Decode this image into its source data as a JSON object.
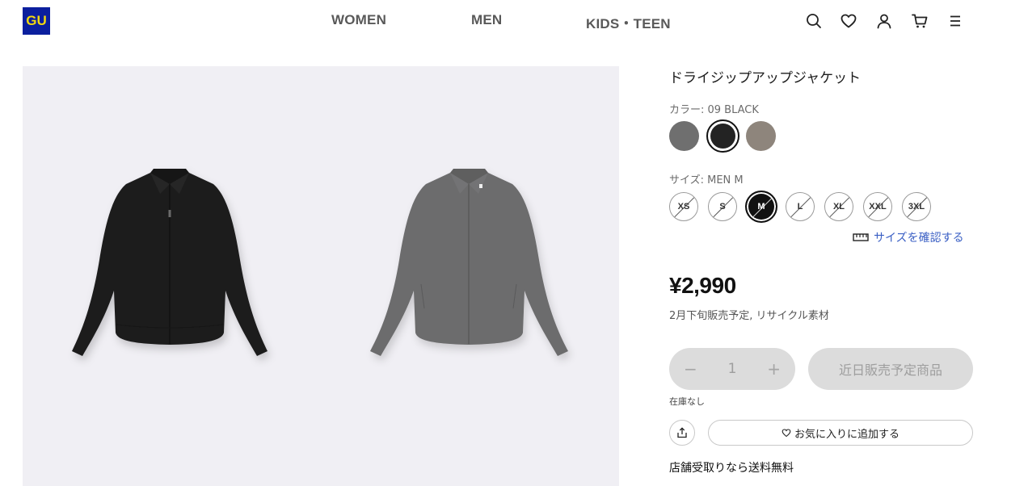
{
  "header": {
    "logo": "GU",
    "nav": [
      "WOMEN",
      "MEN",
      "KIDS・TEEN"
    ],
    "icons": [
      "search-icon",
      "heart-icon",
      "user-icon",
      "cart-icon",
      "menu-icon"
    ]
  },
  "gallery": {
    "images": [
      {
        "description_color": "#1e1e1e",
        "alt": "black jacket"
      },
      {
        "description_color": "#6c6c6d",
        "alt": "gray jacket"
      }
    ],
    "background": "#f0eff4"
  },
  "product": {
    "title": "ドライジップアップジャケット",
    "color_label": "カラー: 09 BLACK",
    "colors": [
      {
        "hex": "#6f6f6f",
        "selected": false
      },
      {
        "hex": "#232323",
        "selected": true
      },
      {
        "hex": "#8e857c",
        "selected": false
      }
    ],
    "size_label": "サイズ: MEN M",
    "sizes": [
      {
        "label": "XS",
        "selected": false,
        "unavailable": true
      },
      {
        "label": "S",
        "selected": false,
        "unavailable": true
      },
      {
        "label": "M",
        "selected": true,
        "unavailable": true
      },
      {
        "label": "L",
        "selected": false,
        "unavailable": true
      },
      {
        "label": "XL",
        "selected": false,
        "unavailable": true
      },
      {
        "label": "XXL",
        "selected": false,
        "unavailable": true
      },
      {
        "label": "3XL",
        "selected": false,
        "unavailable": true
      }
    ],
    "size_check_link": "サイズを確認する",
    "price": "¥2,990",
    "note": "2月下旬販売予定,  リサイクル素材",
    "quantity": {
      "minus": "−",
      "value": "1",
      "plus": "+"
    },
    "cta_label": "近日販売予定商品",
    "stock_status": "在庫なし",
    "favorite_label": "お気に入りに追加する",
    "shipping_note": "店舗受取りなら送料無料"
  },
  "colors": {
    "logo_bg": "#0b1f9e",
    "logo_text": "#f3d90f",
    "link": "#3a5fc4",
    "disabled_bg": "#dcdcdc"
  }
}
